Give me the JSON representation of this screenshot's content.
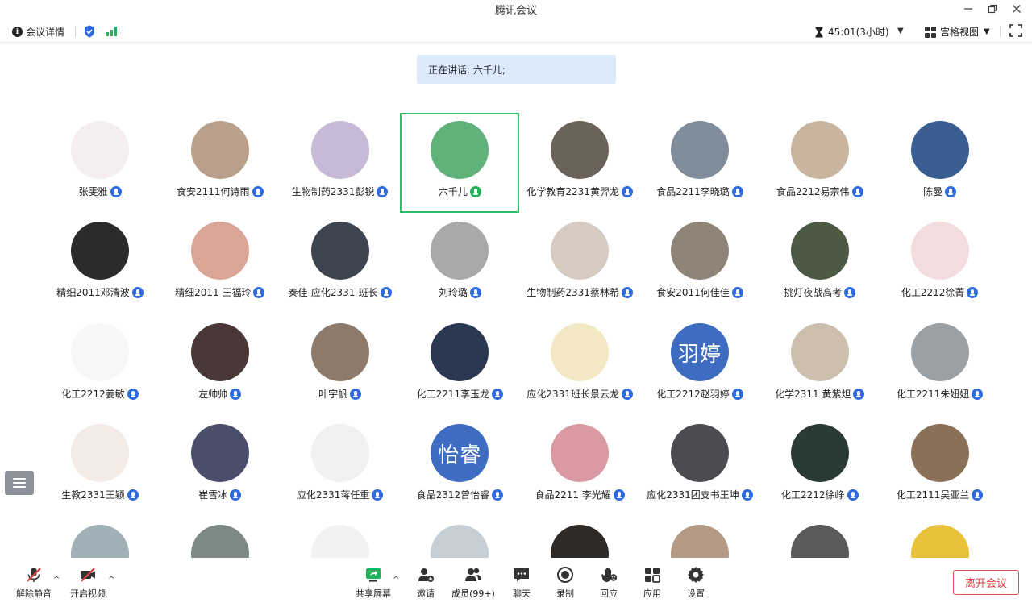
{
  "window": {
    "title": "腾讯会议",
    "controls": [
      "minimize-icon",
      "restore-icon",
      "close-icon"
    ]
  },
  "infobar": {
    "meeting_detail": "会议详情",
    "timer": "45:01(3小时)",
    "view_mode": "宫格视图"
  },
  "speaking": {
    "text": "正在讲话: 六千儿;"
  },
  "colors": {
    "accent_blue": "#2f6bde",
    "speaking_green": "#1fb25a",
    "leave_red": "#e03a3a",
    "banner_bg": "#dce9fb"
  },
  "participants": [
    {
      "name": "张雯雅",
      "avatar_text": "",
      "color": "#f5eeee"
    },
    {
      "name": "食安2111何诗雨",
      "avatar_text": "",
      "color": "#b8a08a"
    },
    {
      "name": "生物制药2331彭锐",
      "avatar_text": "",
      "color": "#c7b9d8"
    },
    {
      "name": "六千儿",
      "avatar_text": "",
      "color": "#5fb27a",
      "active": true
    },
    {
      "name": "化学教育2231黄羿龙",
      "avatar_text": "",
      "color": "#6b6259"
    },
    {
      "name": "食品2211李晓璐",
      "avatar_text": "",
      "color": "#7f8d9a"
    },
    {
      "name": "食品2212易宗伟",
      "avatar_text": "",
      "color": "#c9b49f"
    },
    {
      "name": "陈曼",
      "avatar_text": "",
      "color": "#3a5d92"
    },
    {
      "name": "精细2011邓清波",
      "avatar_text": "",
      "color": "#2b2b2d"
    },
    {
      "name": "精细2011 王福玲",
      "avatar_text": "",
      "color": "#d9a596"
    },
    {
      "name": "秦佳-应化2331-班长",
      "avatar_text": "",
      "color": "#3e4550"
    },
    {
      "name": "刘玲璐",
      "avatar_text": "",
      "color": "#a9a9ab"
    },
    {
      "name": "生物制药2331蔡林希",
      "avatar_text": "",
      "color": "#d6cbc0"
    },
    {
      "name": "食安2011何佳佳",
      "avatar_text": "",
      "color": "#8f8478"
    },
    {
      "name": "挑灯夜战高考",
      "avatar_text": "",
      "color": "#4c5a44"
    },
    {
      "name": "化工2212徐菁",
      "avatar_text": "",
      "color": "#f3dcdf"
    },
    {
      "name": "化工2212姜敏",
      "avatar_text": "",
      "color": "#f7f7f7"
    },
    {
      "name": "左帅帅",
      "avatar_text": "",
      "color": "#4a3838"
    },
    {
      "name": "叶宇帆",
      "avatar_text": "",
      "color": "#8e7a6a"
    },
    {
      "name": "化工2211李玉龙",
      "avatar_text": "",
      "color": "#2a3852"
    },
    {
      "name": "应化2331班长景云龙",
      "avatar_text": "",
      "color": "#f2e9c4"
    },
    {
      "name": "化工2212赵羽婷",
      "avatar_text": "羽婷",
      "color": "#3d6cc0"
    },
    {
      "name": "化学2311 黄紫炟",
      "avatar_text": "",
      "color": "#cdbfae"
    },
    {
      "name": "化工2211朱妞妞",
      "avatar_text": "",
      "color": "#9aa0a4"
    },
    {
      "name": "生教2331王颖",
      "avatar_text": "",
      "color": "#f4ebe6"
    },
    {
      "name": "崔雪冰",
      "avatar_text": "",
      "color": "#4b4e6a"
    },
    {
      "name": "应化2331蒋任重",
      "avatar_text": "",
      "color": "#f1f1ef"
    },
    {
      "name": "食品2312曾怡睿",
      "avatar_text": "怡睿",
      "color": "#3d6cc0"
    },
    {
      "name": "食品2211 李光耀",
      "avatar_text": "",
      "color": "#d99aa3"
    },
    {
      "name": "应化2331团支书王坤",
      "avatar_text": "",
      "color": "#4a4c50"
    },
    {
      "name": "化工2212徐峥",
      "avatar_text": "",
      "color": "#2a3a36"
    },
    {
      "name": "化工2111吴亚兰",
      "avatar_text": "",
      "color": "#8a7056"
    },
    {
      "name": "",
      "avatar_text": "",
      "color": "#9fb0b6"
    },
    {
      "name": "",
      "avatar_text": "",
      "color": "#7d8a84"
    },
    {
      "name": "",
      "avatar_text": "",
      "color": "#f4f1f1"
    },
    {
      "name": "",
      "avatar_text": "",
      "color": "#c6cfd6"
    },
    {
      "name": "",
      "avatar_text": "",
      "color": "#2d2a27"
    },
    {
      "name": "",
      "avatar_text": "",
      "color": "#b49a84"
    },
    {
      "name": "",
      "avatar_text": "",
      "color": "#5a5a58"
    },
    {
      "name": "",
      "avatar_text": "",
      "color": "#e9c23b"
    }
  ],
  "toolbar": {
    "unmute": "解除静音",
    "start_video": "开启视频",
    "share_screen": "共享屏幕",
    "invite": "邀请",
    "members": "成员(99+)",
    "chat": "聊天",
    "record": "录制",
    "reaction": "回应",
    "apps": "应用",
    "settings": "设置",
    "leave": "离开会议"
  }
}
